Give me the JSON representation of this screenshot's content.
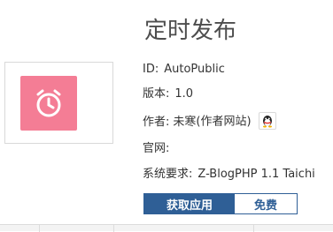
{
  "app": {
    "title": "定时发布",
    "accent_color": "#2f5f96",
    "icon": {
      "name": "alarm-clock-icon",
      "background": "#f47d95"
    }
  },
  "details": {
    "id_label": "ID:",
    "id_value": "AutoPublic",
    "version_label": "版本:",
    "version_value": "1.0",
    "author_label": "作者:",
    "author_name": "未寒",
    "author_site": "(作者网站)",
    "author_contact_icon": "qq-penguin-icon",
    "website_label": "官网:",
    "website_value": "",
    "requirement_label": "系统要求:",
    "requirement_value": "Z-BlogPHP 1.1 Taichi"
  },
  "actions": {
    "get_app_label": "获取应用",
    "price_label": "免费"
  }
}
